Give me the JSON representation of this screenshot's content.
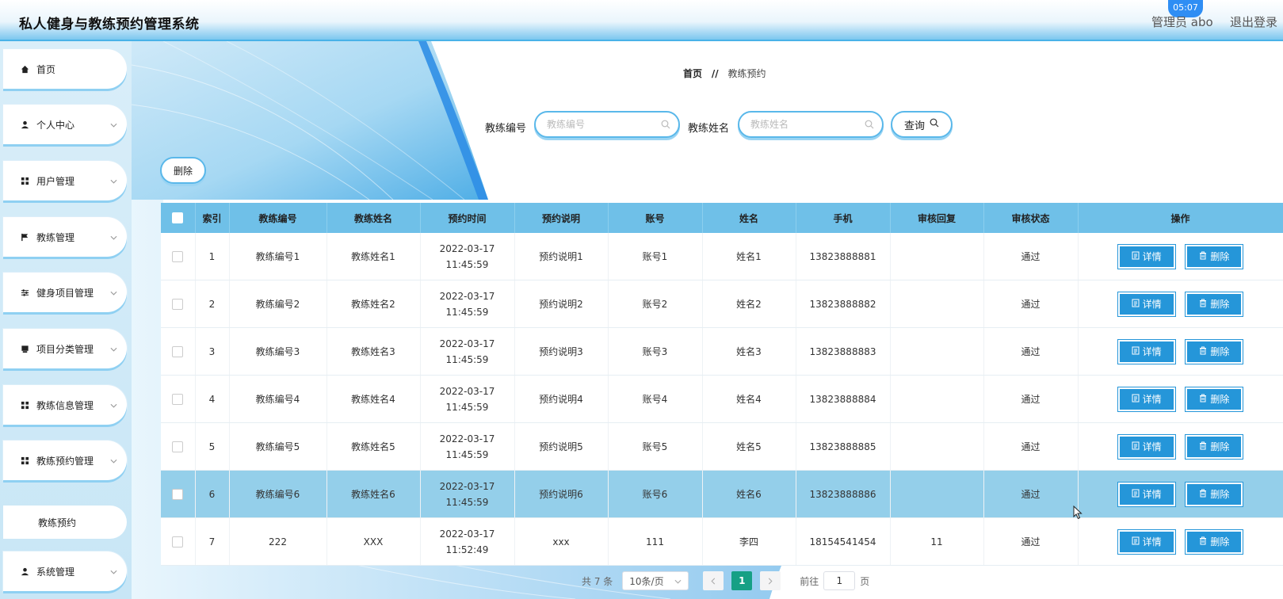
{
  "header": {
    "title": "私人健身与教练预约管理系统",
    "clock": "05:07",
    "user": "管理员 abo",
    "logout": "退出登录"
  },
  "sidebar": {
    "items": [
      {
        "label": "首页",
        "icon": "home-icon"
      },
      {
        "label": "个人中心",
        "icon": "user-icon"
      },
      {
        "label": "用户管理",
        "icon": "grid-icon"
      },
      {
        "label": "教练管理",
        "icon": "flag-icon"
      },
      {
        "label": "健身项目管理",
        "icon": "sliders-icon"
      },
      {
        "label": "项目分类管理",
        "icon": "box-icon"
      },
      {
        "label": "教练信息管理",
        "icon": "grid-icon"
      },
      {
        "label": "教练预约管理",
        "icon": "grid-icon"
      },
      {
        "label": "系统管理",
        "icon": "user-icon"
      }
    ],
    "sub_item": "教练预约"
  },
  "breadcrumb": {
    "home": "首页",
    "separator": "//",
    "current": "教练预约"
  },
  "search": {
    "coach_no_label": "教练编号",
    "coach_no_placeholder": "教练编号",
    "coach_name_label": "教练姓名",
    "coach_name_placeholder": "教练姓名",
    "query_label": "查询"
  },
  "toolbar": {
    "delete_label": "删除"
  },
  "table": {
    "headers": [
      "索引",
      "教练编号",
      "教练姓名",
      "预约时间",
      "预约说明",
      "账号",
      "姓名",
      "手机",
      "审核回复",
      "审核状态",
      "操作"
    ],
    "rows": [
      {
        "index": "1",
        "coach_no": "教练编号1",
        "coach_name": "教练姓名1",
        "time": "2022-03-17 11:45:59",
        "desc": "预约说明1",
        "account": "账号1",
        "name": "姓名1",
        "phone": "13823888881",
        "reply": "",
        "status": "通过"
      },
      {
        "index": "2",
        "coach_no": "教练编号2",
        "coach_name": "教练姓名2",
        "time": "2022-03-17 11:45:59",
        "desc": "预约说明2",
        "account": "账号2",
        "name": "姓名2",
        "phone": "13823888882",
        "reply": "",
        "status": "通过"
      },
      {
        "index": "3",
        "coach_no": "教练编号3",
        "coach_name": "教练姓名3",
        "time": "2022-03-17 11:45:59",
        "desc": "预约说明3",
        "account": "账号3",
        "name": "姓名3",
        "phone": "13823888883",
        "reply": "",
        "status": "通过"
      },
      {
        "index": "4",
        "coach_no": "教练编号4",
        "coach_name": "教练姓名4",
        "time": "2022-03-17 11:45:59",
        "desc": "预约说明4",
        "account": "账号4",
        "name": "姓名4",
        "phone": "13823888884",
        "reply": "",
        "status": "通过"
      },
      {
        "index": "5",
        "coach_no": "教练编号5",
        "coach_name": "教练姓名5",
        "time": "2022-03-17 11:45:59",
        "desc": "预约说明5",
        "account": "账号5",
        "name": "姓名5",
        "phone": "13823888885",
        "reply": "",
        "status": "通过"
      },
      {
        "index": "6",
        "coach_no": "教练编号6",
        "coach_name": "教练姓名6",
        "time": "2022-03-17 11:45:59",
        "desc": "预约说明6",
        "account": "账号6",
        "name": "姓名6",
        "phone": "13823888886",
        "reply": "",
        "status": "通过"
      },
      {
        "index": "7",
        "coach_no": "222",
        "coach_name": "XXX",
        "time": "2022-03-17 11:52:49",
        "desc": "xxx",
        "account": "111",
        "name": "李四",
        "phone": "18154541454",
        "reply": "11",
        "status": "通过"
      }
    ],
    "detail_label": "详情",
    "delete_label": "删除"
  },
  "pagination": {
    "total": "共 7 条",
    "page_size": "10条/页",
    "current_page": "1",
    "goto_label": "前往",
    "goto_value": "1",
    "page_unit": "页"
  },
  "colors": {
    "accent": "#2596d9",
    "header_row": "#6fc0e8",
    "hover_row": "#94cfea",
    "page_active": "#16a085"
  }
}
